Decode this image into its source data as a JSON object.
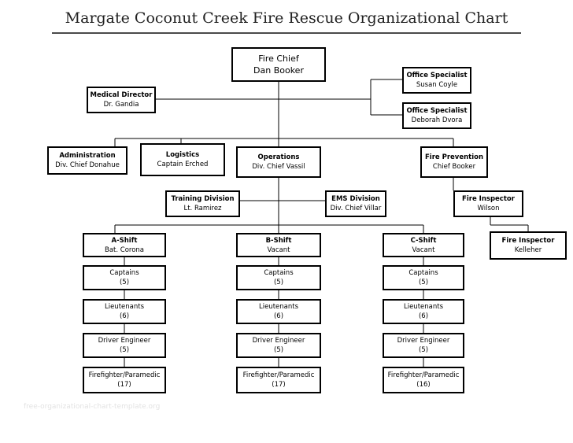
{
  "title": "Margate Coconut Creek Fire Rescue Organizational Chart",
  "watermark": "free-organizational-chart-template.org",
  "nodes": {
    "fire_chief": {
      "title": "Fire Chief",
      "name": "Dan Booker"
    },
    "medical_director": {
      "title": "Medical Director",
      "name": "Dr. Gandia"
    },
    "office_specialist_1": {
      "title": "Office Specialist",
      "name": "Susan Coyle"
    },
    "office_specialist_2": {
      "title": "Office Specialist",
      "name": "Deborah Dvora"
    },
    "administration": {
      "title": "Administration",
      "name": "Div. Chief Donahue"
    },
    "logistics": {
      "title": "Logistics",
      "name": "Captain Erched"
    },
    "operations": {
      "title": "Operations",
      "name": "Div. Chief Vassil"
    },
    "fire_prevention": {
      "title": "Fire Prevention",
      "name": "Chief Booker"
    },
    "training_division": {
      "title": "Training Division",
      "name": "Lt. Ramirez"
    },
    "ems_division": {
      "title": "EMS Division",
      "name": "Div. Chief Villar"
    },
    "fire_inspector_1": {
      "title": "Fire Inspector",
      "name": "Wilson"
    },
    "fire_inspector_2": {
      "title": "Fire Inspector",
      "name": "Kelleher"
    }
  },
  "shifts": [
    {
      "title": "A-Shift",
      "name": "Bat. Corona",
      "roles": [
        {
          "label": "Captains",
          "count": "(5)"
        },
        {
          "label": "Lieutenants",
          "count": "(6)"
        },
        {
          "label": "Driver Engineer",
          "count": "(5)"
        },
        {
          "label": "Firefighter/Paramedic",
          "count": "(17)"
        }
      ]
    },
    {
      "title": "B-Shift",
      "name": "Vacant",
      "roles": [
        {
          "label": "Captains",
          "count": "(5)"
        },
        {
          "label": "Lieutenants",
          "count": "(6)"
        },
        {
          "label": "Driver Engineer",
          "count": "(5)"
        },
        {
          "label": "Firefighter/Paramedic",
          "count": "(17)"
        }
      ]
    },
    {
      "title": "C-Shift",
      "name": "Vacant",
      "roles": [
        {
          "label": "Captains",
          "count": "(5)"
        },
        {
          "label": "Lieutenants",
          "count": "(6)"
        },
        {
          "label": "Driver Engineer",
          "count": "(5)"
        },
        {
          "label": "Firefighter/Paramedic",
          "count": "(16)"
        }
      ]
    }
  ]
}
